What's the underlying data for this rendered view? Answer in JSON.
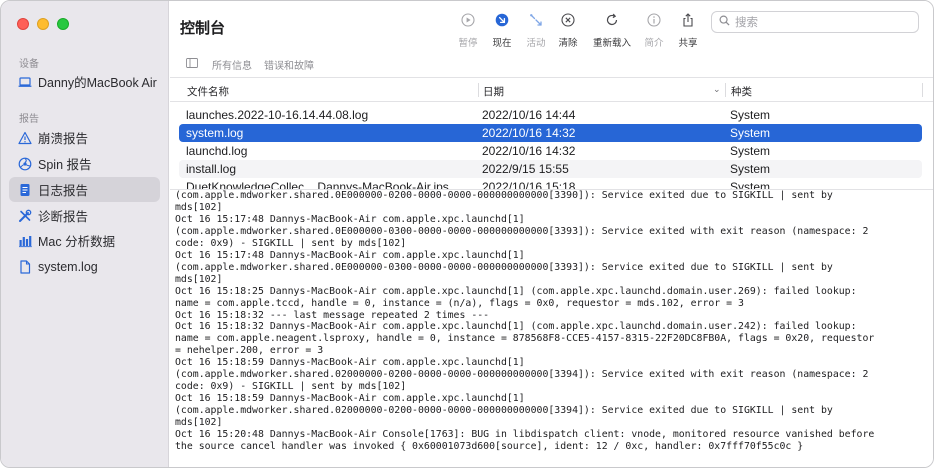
{
  "sidebar": {
    "devices_header": "设备",
    "device": {
      "label": "Danny的MacBook Air",
      "icon": "laptop-icon"
    },
    "reports_header": "报告",
    "items": [
      {
        "label": "崩溃报告",
        "icon": "warning-icon"
      },
      {
        "label": "Spin 报告",
        "icon": "spin-icon"
      },
      {
        "label": "日志报告",
        "icon": "document-icon",
        "selected": true
      },
      {
        "label": "诊断报告",
        "icon": "tools-icon"
      },
      {
        "label": "Mac 分析数据",
        "icon": "bar-chart-icon"
      },
      {
        "label": "system.log",
        "icon": "file-icon"
      }
    ]
  },
  "header": {
    "title": "控制台",
    "toolbar": [
      {
        "label": "暂停",
        "icon": "pause-icon",
        "enabled": false
      },
      {
        "label": "现在",
        "icon": "now-icon",
        "enabled": true
      },
      {
        "label": "活动",
        "icon": "activity-icon",
        "enabled": false
      },
      {
        "label": "清除",
        "icon": "clear-icon",
        "enabled": true
      },
      {
        "label": "重新载入",
        "icon": "reload-icon",
        "enabled": true
      },
      {
        "label": "简介",
        "icon": "info-icon",
        "enabled": false
      },
      {
        "label": "共享",
        "icon": "share-icon",
        "enabled": true
      }
    ],
    "search_placeholder": "搜索"
  },
  "filter_tabs": [
    "所有信息",
    "错误和故障"
  ],
  "columns": {
    "name": "文件名称",
    "date": "日期",
    "kind": "种类"
  },
  "files": [
    {
      "name": "launches.2022-10-16.14.44.08.log",
      "date": "2022/10/16 14:44",
      "kind": "System"
    },
    {
      "name": "system.log",
      "date": "2022/10/16 14:32",
      "kind": "System",
      "selected": true
    },
    {
      "name": "launchd.log",
      "date": "2022/10/16 14:32",
      "kind": "System"
    },
    {
      "name": "install.log",
      "date": "2022/9/15 15:55",
      "kind": "System"
    },
    {
      "name": "DuetKnowledgeCollec... Dannys-MacBook-Air.ips",
      "date": "2022/10/16 15:18",
      "kind": "System"
    }
  ],
  "log_lines": [
    "(com.apple.mdworker.shared.0E000000-0200-0000-0000-000000000000[3390]): Service exited due to SIGKILL | sent by",
    "mds[102]",
    "Oct 16 15:17:48 Dannys-MacBook-Air com.apple.xpc.launchd[1]",
    "(com.apple.mdworker.shared.0E000000-0300-0000-0000-000000000000[3393]): Service exited with exit reason (namespace: 2",
    "code: 0x9) - SIGKILL | sent by mds[102]",
    "Oct 16 15:17:48 Dannys-MacBook-Air com.apple.xpc.launchd[1]",
    "(com.apple.mdworker.shared.0E000000-0300-0000-0000-000000000000[3393]): Service exited due to SIGKILL | sent by",
    "mds[102]",
    "Oct 16 15:18:25 Dannys-MacBook-Air com.apple.xpc.launchd[1] (com.apple.xpc.launchd.domain.user.269): failed lookup:",
    "name = com.apple.tccd, handle = 0, instance = (n/a), flags = 0x0, requestor = mds.102, error = 3",
    "Oct 16 15:18:32 --- last message repeated 2 times ---",
    "Oct 16 15:18:32 Dannys-MacBook-Air com.apple.xpc.launchd[1] (com.apple.xpc.launchd.domain.user.242): failed lookup:",
    "name = com.apple.neagent.lsproxy, handle = 0, instance = 878568F8-CCE5-4157-8315-22F20DC8FB0A, flags = 0x20, requestor",
    "= nehelper.200, error = 3",
    "Oct 16 15:18:59 Dannys-MacBook-Air com.apple.xpc.launchd[1]",
    "(com.apple.mdworker.shared.02000000-0200-0000-0000-000000000000[3394]): Service exited with exit reason (namespace: 2",
    "code: 0x9) - SIGKILL | sent by mds[102]",
    "Oct 16 15:18:59 Dannys-MacBook-Air com.apple.xpc.launchd[1]",
    "(com.apple.mdworker.shared.02000000-0200-0000-0000-000000000000[3394]): Service exited due to SIGKILL | sent by",
    "mds[102]",
    "Oct 16 15:20:48 Dannys-MacBook-Air Console[1763]: BUG in libdispatch client: vnode, monitored resource vanished before",
    "the source cancel handler was invoked { 0x60001073d600[source], ident: 12 / 0xc, handler: 0x7fff70f55c0c }"
  ],
  "colors": {
    "accent": "#2766d6",
    "sidebar_bg": "#e9e7ec",
    "sidebar_selected": "#d5d3d9"
  }
}
